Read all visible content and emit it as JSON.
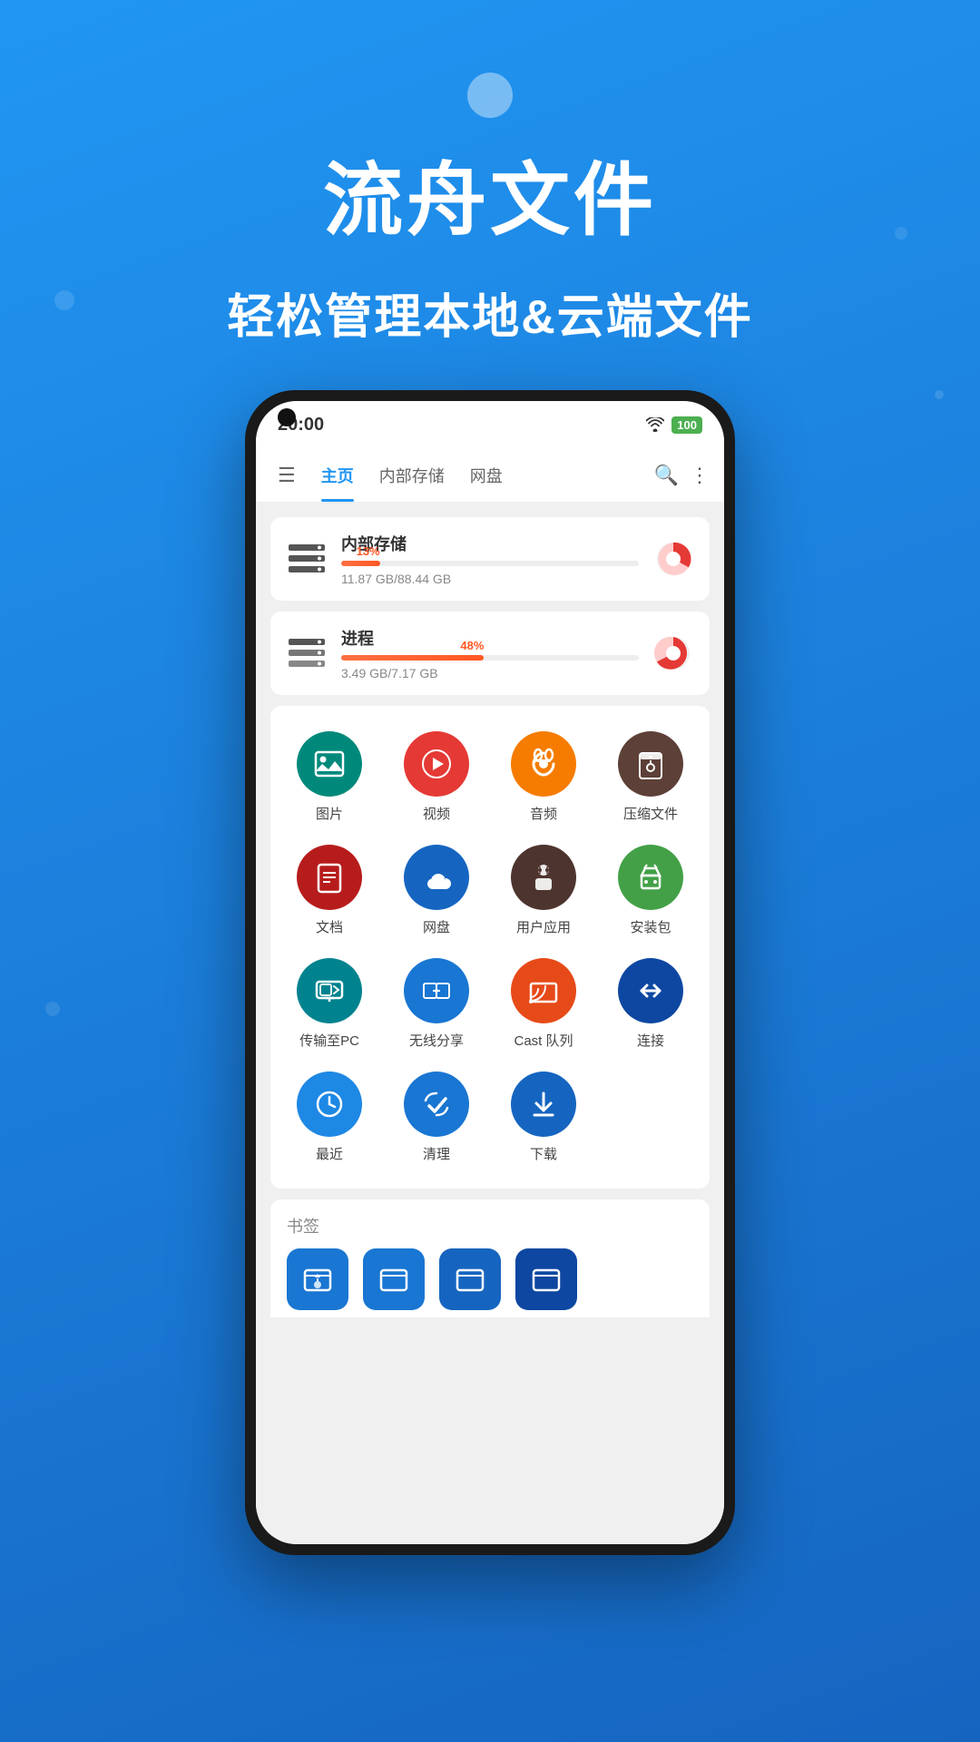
{
  "app": {
    "title": "流舟文件",
    "subtitle": "轻松管理本地&云端文件"
  },
  "phone": {
    "statusBar": {
      "time": "20:00",
      "wifi": "📶",
      "battery": "100"
    },
    "tabs": [
      {
        "label": "主页",
        "active": true
      },
      {
        "label": "内部存储",
        "active": false
      },
      {
        "label": "网盘",
        "active": false
      }
    ],
    "storage": [
      {
        "name": "内部存储",
        "percent": 13,
        "percentLabel": "13%",
        "size": "11.87 GB/88.44 GB",
        "barColor": "#ff5722"
      },
      {
        "name": "进程",
        "percent": 48,
        "percentLabel": "48%",
        "size": "3.49 GB/7.17 GB",
        "barColor": "#ff5722"
      }
    ],
    "icons": [
      {
        "label": "图片",
        "color": "ic-teal",
        "icon": "🖼"
      },
      {
        "label": "视频",
        "color": "ic-red",
        "icon": "▶"
      },
      {
        "label": "音频",
        "color": "ic-orange",
        "icon": "🎧"
      },
      {
        "label": "压缩文件",
        "color": "ic-brown",
        "icon": "📦"
      },
      {
        "label": "文档",
        "color": "ic-darkred",
        "icon": "📄"
      },
      {
        "label": "网盘",
        "color": "ic-blue",
        "icon": "☁"
      },
      {
        "label": "用户应用",
        "color": "ic-darkbrown",
        "icon": "🤖"
      },
      {
        "label": "安装包",
        "color": "ic-green",
        "icon": "🤖"
      },
      {
        "label": "传输至PC",
        "color": "ic-teal2",
        "icon": "💻"
      },
      {
        "label": "无线分享",
        "color": "ic-blue2",
        "icon": "📱"
      },
      {
        "label": "Cast 队列",
        "color": "ic-deeporange",
        "icon": "📡"
      },
      {
        "label": "连接",
        "color": "ic-darkblue",
        "icon": "↔"
      },
      {
        "label": "最近",
        "color": "ic-blue3",
        "icon": "🕐"
      },
      {
        "label": "清理",
        "color": "ic-blue4",
        "icon": "✔"
      },
      {
        "label": "下载",
        "color": "ic-blue5",
        "icon": "⬇"
      }
    ],
    "bookmarks": {
      "label": "书签",
      "items": [
        "📁",
        "📁",
        "📁",
        "📁"
      ]
    }
  }
}
